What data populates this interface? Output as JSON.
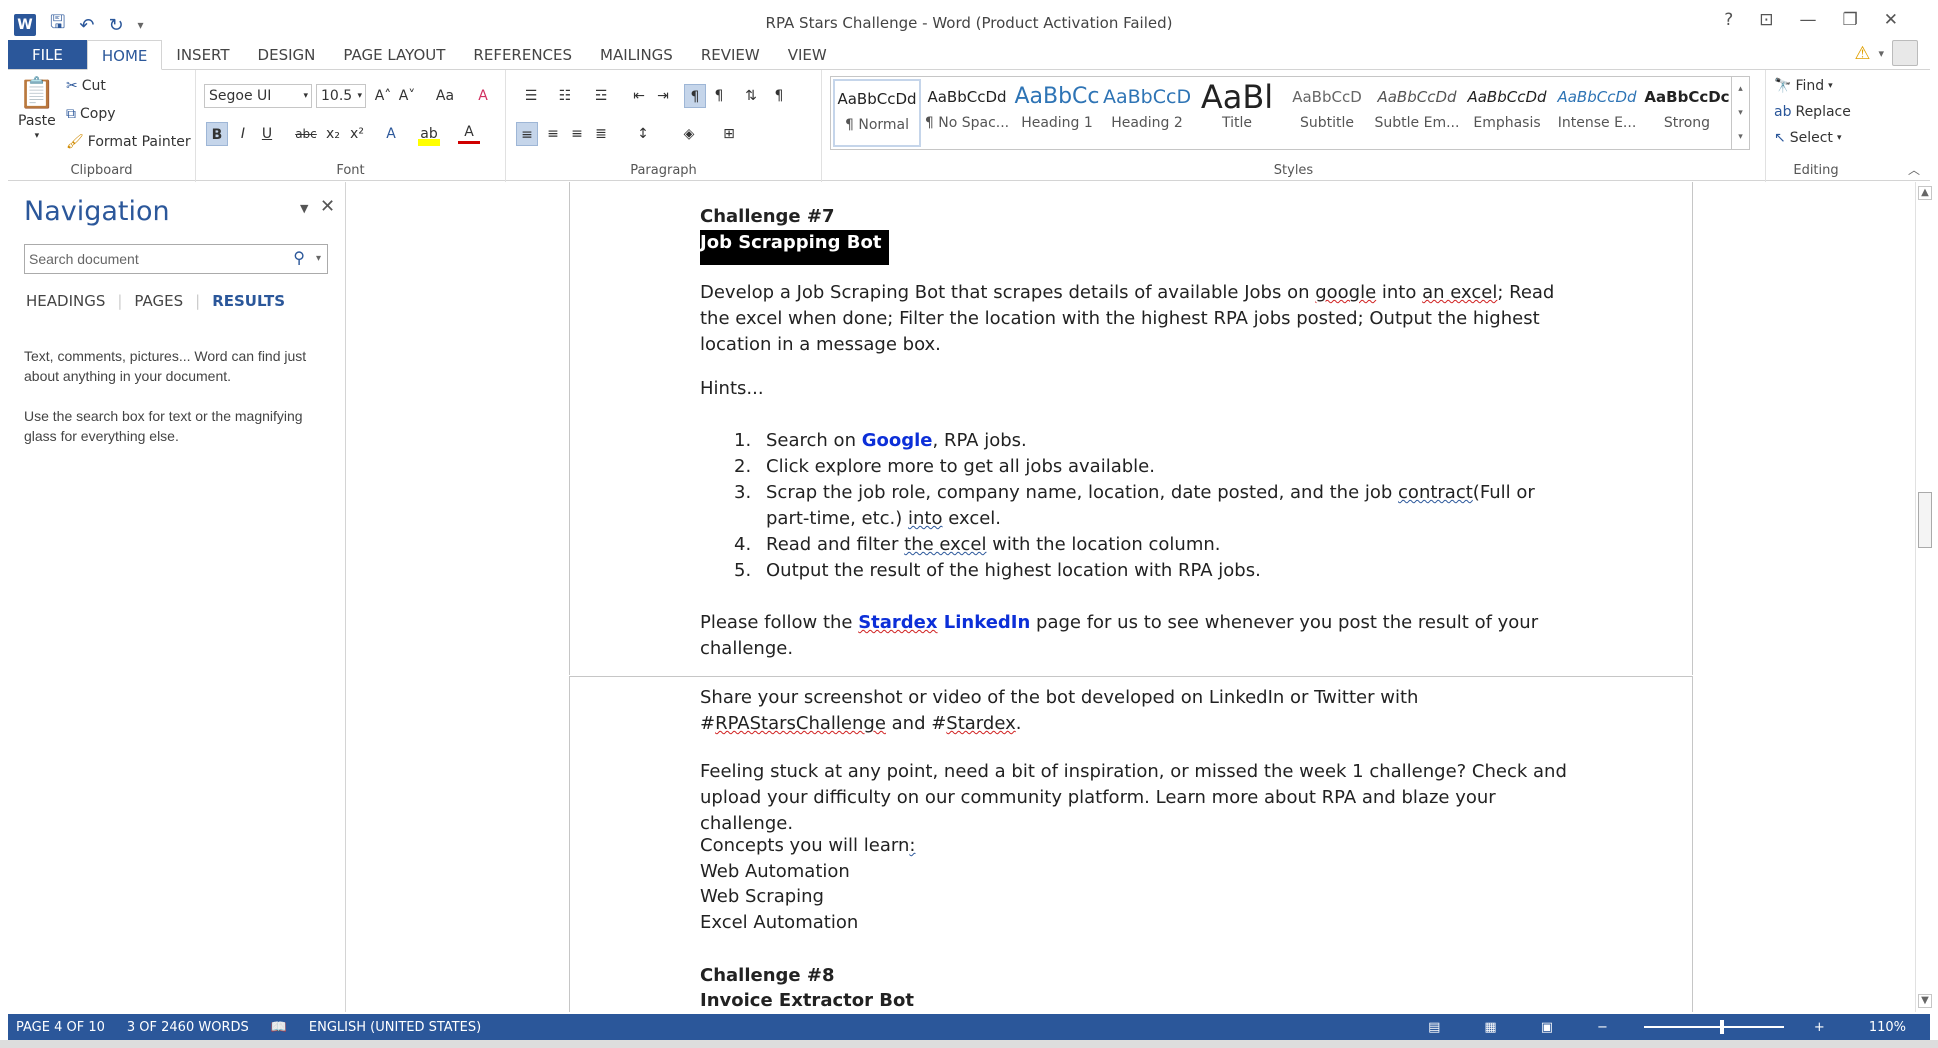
{
  "window": {
    "title": "RPA Stars Challenge - Word (Product Activation Failed)",
    "controls": {
      "help": "?",
      "restore_ribbon": "⊡",
      "minimize": "—",
      "maximize": "❐",
      "close": "✕"
    }
  },
  "qat": {
    "app_icon": "W",
    "save_icon": "save-icon",
    "undo_icon": "undo-icon",
    "redo_icon": "redo-icon"
  },
  "tabs": [
    {
      "label": "FILE"
    },
    {
      "label": "HOME"
    },
    {
      "label": "INSERT"
    },
    {
      "label": "DESIGN"
    },
    {
      "label": "PAGE LAYOUT"
    },
    {
      "label": "REFERENCES"
    },
    {
      "label": "MAILINGS"
    },
    {
      "label": "REVIEW"
    },
    {
      "label": "VIEW"
    }
  ],
  "ribbon": {
    "clipboard": {
      "paste": "Paste",
      "cut": "Cut",
      "copy": "Copy",
      "format_painter": "Format Painter",
      "label": "Clipboard"
    },
    "font": {
      "family": "Segoe UI",
      "size": "10.5",
      "label": "Font",
      "bold": "B",
      "italic": "I",
      "underline": "U",
      "strike": "abc",
      "sub": "x₂",
      "sup": "x²",
      "grow": "A˄",
      "shrink": "A˅",
      "case": "Aa",
      "clear": "A"
    },
    "paragraph": {
      "label": "Paragraph",
      "pilcrow": "¶"
    },
    "styles": {
      "label": "Styles",
      "items": [
        {
          "sample": "AaBbCcDd",
          "name": "¶ Normal"
        },
        {
          "sample": "AaBbCcDd",
          "name": "¶ No Spac..."
        },
        {
          "sample": "AaBbCc",
          "name": "Heading 1"
        },
        {
          "sample": "AaBbCcD",
          "name": "Heading 2"
        },
        {
          "sample": "AaBl",
          "name": "Title"
        },
        {
          "sample": "AaBbCcD",
          "name": "Subtitle"
        },
        {
          "sample": "AaBbCcDd",
          "name": "Subtle Em..."
        },
        {
          "sample": "AaBbCcDd",
          "name": "Emphasis"
        },
        {
          "sample": "AaBbCcDd",
          "name": "Intense E..."
        },
        {
          "sample": "AaBbCcDc",
          "name": "Strong"
        }
      ]
    },
    "editing": {
      "label": "Editing",
      "find": "Find",
      "replace": "Replace",
      "select": "Select"
    }
  },
  "nav": {
    "title": "Navigation",
    "search_placeholder": "Search document",
    "tabs": {
      "headings": "HEADINGS",
      "pages": "PAGES",
      "results": "RESULTS"
    },
    "help1": "Text, comments, pictures... Word can find just about anything in your document.",
    "help2": "Use the search box for text or the magnifying glass for everything else."
  },
  "doc": {
    "challenge7_title": "Challenge #7",
    "challenge7_sub": "Job Scrapping Bot",
    "p1_a": "Develop a Job Scraping Bot that scrapes details of available Jobs on ",
    "p1_google": "google",
    "p1_b": " into ",
    "p1_anexcel": "an excel",
    "p1_c": "; Read the excel when done; Filter the location with the highest RPA jobs posted; Output the highest location in a message box.",
    "hints": "Hints...",
    "list": [
      {
        "num": "1.",
        "pre": "Search on ",
        "link": "Google",
        "post": ", RPA jobs."
      },
      {
        "num": "2.",
        "text": "Click explore more to get all jobs available."
      },
      {
        "num": "3.",
        "pre": "Scrap the job role, company name, location, date posted, and the job ",
        "wavy": "contract",
        "post": "(Full or part-time, etc.)  ",
        "wavy2": "into",
        "post2": " excel."
      },
      {
        "num": "4.",
        "pre": "Read and filter ",
        "wavy": "the excel",
        "post": " with the location column."
      },
      {
        "num": "5.",
        "text": "Output the result of the highest location with RPA jobs."
      }
    ],
    "follow_a": "Please follow the ",
    "follow_link1": "Stardex",
    "follow_link2": " LinkedIn",
    "follow_b": " page for us to see whenever you post the result of your challenge.",
    "share_a": "Share your screenshot or video of the bot developed on LinkedIn or Twitter with #",
    "share_tag": "RPAStarsChallenge",
    "share_b": " and #",
    "share_tag2": "Stardex",
    "share_c": ".",
    "stuck": "Feeling stuck at any point, need a bit of inspiration, or missed the week 1 challenge? Check and upload your difficulty on our community platform. Learn more about RPA and blaze your challenge.",
    "concepts": "Concepts you will learn",
    "concepts_colon": ":",
    "c1": "Web Automation",
    "c2": "Web Scraping",
    "c3": "Excel Automation",
    "challenge8_title": "Challenge #8",
    "challenge8_sub": "Invoice Extractor Bot"
  },
  "status": {
    "page": "PAGE 4 OF 10",
    "words": "3 OF 2460 WORDS",
    "language": "ENGLISH (UNITED STATES)",
    "zoom": "110%"
  }
}
